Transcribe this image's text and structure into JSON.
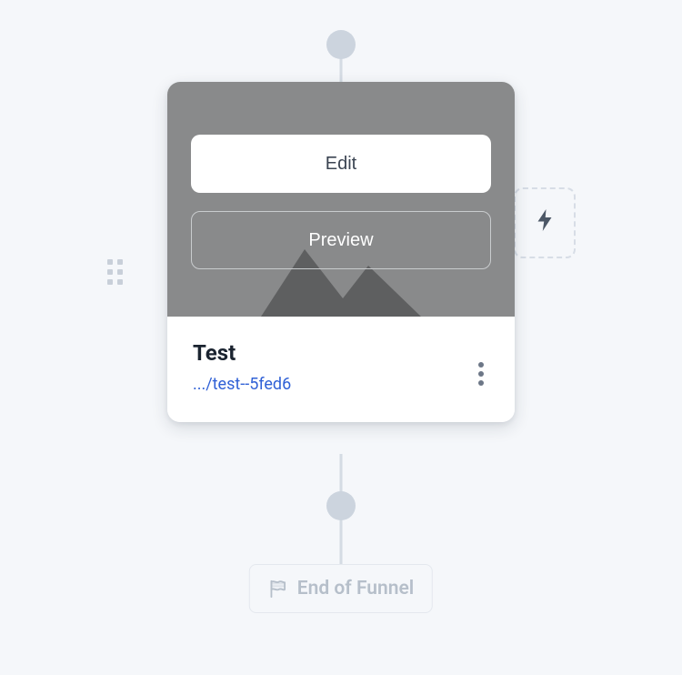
{
  "card": {
    "edit_label": "Edit",
    "preview_label": "Preview",
    "title": "Test",
    "url": ".../test--5fed6"
  },
  "end_of_funnel_label": "End of Funnel"
}
